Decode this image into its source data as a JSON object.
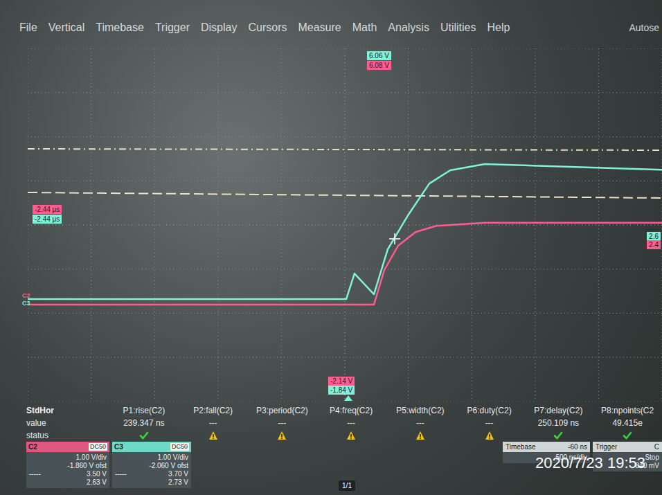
{
  "menu": {
    "items": [
      "File",
      "Vertical",
      "Timebase",
      "Trigger",
      "Display",
      "Cursors",
      "Measure",
      "Math",
      "Analysis",
      "Utilities",
      "Help"
    ],
    "autoset": "Autose"
  },
  "chart": {
    "series": [
      {
        "name": "C3",
        "color": "#7ff2d8",
        "t_ns": [
          -2500,
          11,
          76,
          229,
          338,
          502,
          666,
          830,
          1103,
          2500
        ],
        "v": [
          0.38,
          0.38,
          0.96,
          0.49,
          1.51,
          2.3,
          3.0,
          3.3,
          3.44,
          3.31
        ]
      },
      {
        "name": "C2",
        "color": "#ff5d8f",
        "t_ns": [
          -2500,
          229,
          311,
          420,
          557,
          721,
          1103,
          2500
        ],
        "v": [
          0.056,
          0.056,
          0.84,
          1.39,
          1.7,
          1.84,
          1.91,
          1.91
        ]
      }
    ],
    "channel_markers": [
      {
        "label": "C2",
        "color": "#ff5d8f"
      },
      {
        "label": "C3",
        "color": "#7ff2d8"
      }
    ],
    "top_readouts": [
      {
        "text": "6.06 V",
        "color": "#7ff2d8"
      },
      {
        "text": "6.08 V",
        "color": "#ff5d8f"
      }
    ],
    "left_readouts": [
      {
        "text": "-2.44 μs",
        "color": "#ff5d8f"
      },
      {
        "text": "-2.44 μs",
        "color": "#7ff2d8"
      }
    ],
    "bottom_readouts": [
      {
        "text": "-2.14 V",
        "color": "#ff5d8f"
      },
      {
        "text": "-1.84 V",
        "color": "#7ff2d8"
      }
    ],
    "right_readouts": [
      {
        "text": "2.6",
        "color": "#7ff2d8"
      },
      {
        "text": "2.4",
        "color": "#ff5d8f"
      }
    ]
  },
  "measurements": {
    "header": "StdHor",
    "row_labels": [
      "value",
      "status"
    ],
    "columns": [
      {
        "label": "P1:rise(C2)",
        "value": "239.347 ns",
        "status": "ok"
      },
      {
        "label": "P2:fall(C2)",
        "value": "---",
        "status": "warn"
      },
      {
        "label": "P3:period(C2)",
        "value": "---",
        "status": "warn"
      },
      {
        "label": "P4:freq(C2)",
        "value": "---",
        "status": "warn"
      },
      {
        "label": "P5:width(C2)",
        "value": "---",
        "status": "warn"
      },
      {
        "label": "P6:duty(C2)",
        "value": "---",
        "status": "warn"
      },
      {
        "label": "P7:delay(C2)",
        "value": "250.109 ns",
        "status": "ok"
      },
      {
        "label": "P8:npoints(C2",
        "value": "49.415e",
        "status": "ok"
      }
    ]
  },
  "channels": [
    {
      "name": "C2",
      "coupling": "DC50",
      "color": "#e0577f",
      "scale": "1.00 V/div",
      "offset": "-1.860 V ofst",
      "dash": "-----",
      "line1": "3.50 V",
      "line2": "2.63 V"
    },
    {
      "name": "C3",
      "coupling": "DC50",
      "color": "#6fd8c6",
      "scale": "1.00 V/div",
      "offset": "-2.060 V ofst",
      "dash": "-----",
      "line1": "3.70 V",
      "line2": "2.73 V"
    }
  ],
  "timebase": {
    "label": "Timebase",
    "delay": "-60 ns",
    "scale": "500 ns/div"
  },
  "trigger": {
    "label": "Trigger",
    "source": "C",
    "mode": "Stop",
    "level": "840 mV"
  },
  "page": "1/1",
  "timestamp": "2020/7/23 19:53"
}
